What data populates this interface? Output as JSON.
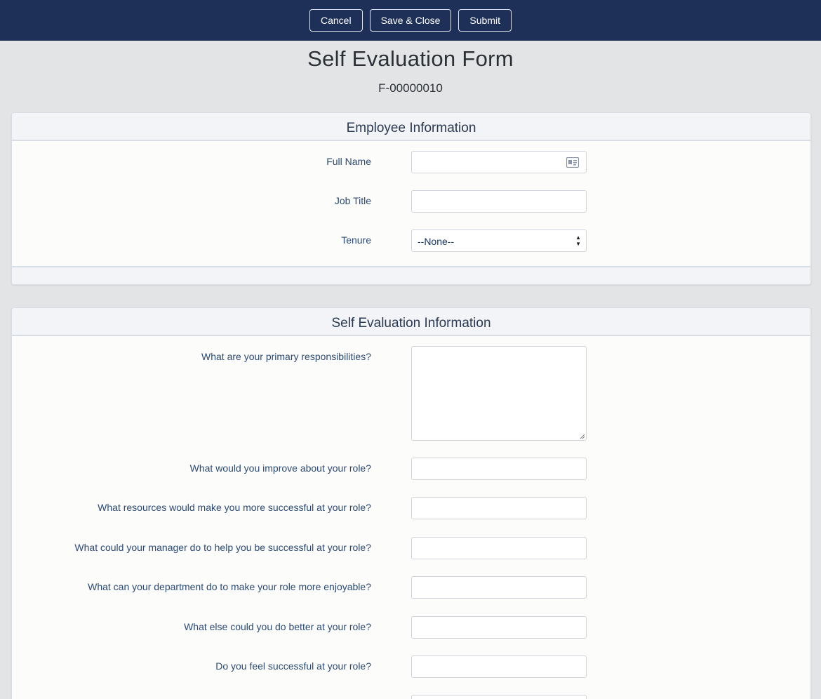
{
  "toolbar": {
    "cancel_label": "Cancel",
    "save_close_label": "Save & Close",
    "submit_label": "Submit"
  },
  "page": {
    "title": "Self Evaluation Form",
    "form_id": "F-00000010"
  },
  "employee_section": {
    "title": "Employee Information",
    "fields": {
      "full_name": {
        "label": "Full Name",
        "value": "",
        "icon": "contact-card-icon"
      },
      "job_title": {
        "label": "Job Title",
        "value": ""
      },
      "tenure": {
        "label": "Tenure",
        "value": "--None--"
      }
    }
  },
  "evaluation_section": {
    "title": "Self Evaluation Information",
    "questions": [
      {
        "label": "What are your primary responsibilities?",
        "value": ""
      },
      {
        "label": "What would you improve about your role?",
        "value": ""
      },
      {
        "label": "What resources would make you more successful at your role?",
        "value": ""
      },
      {
        "label": "What could your manager do to help you be successful at your role?",
        "value": ""
      },
      {
        "label": "What can your department do to make your role more enjoyable?",
        "value": ""
      },
      {
        "label": "What else could you do better at your role?",
        "value": ""
      },
      {
        "label": "Do you feel successful at your role?",
        "value": ""
      }
    ]
  },
  "colors": {
    "header_bar": "#1e3057",
    "page_bg": "#e3e4e6",
    "label_text": "#2b4a74",
    "field_border": "#cfd4db"
  }
}
